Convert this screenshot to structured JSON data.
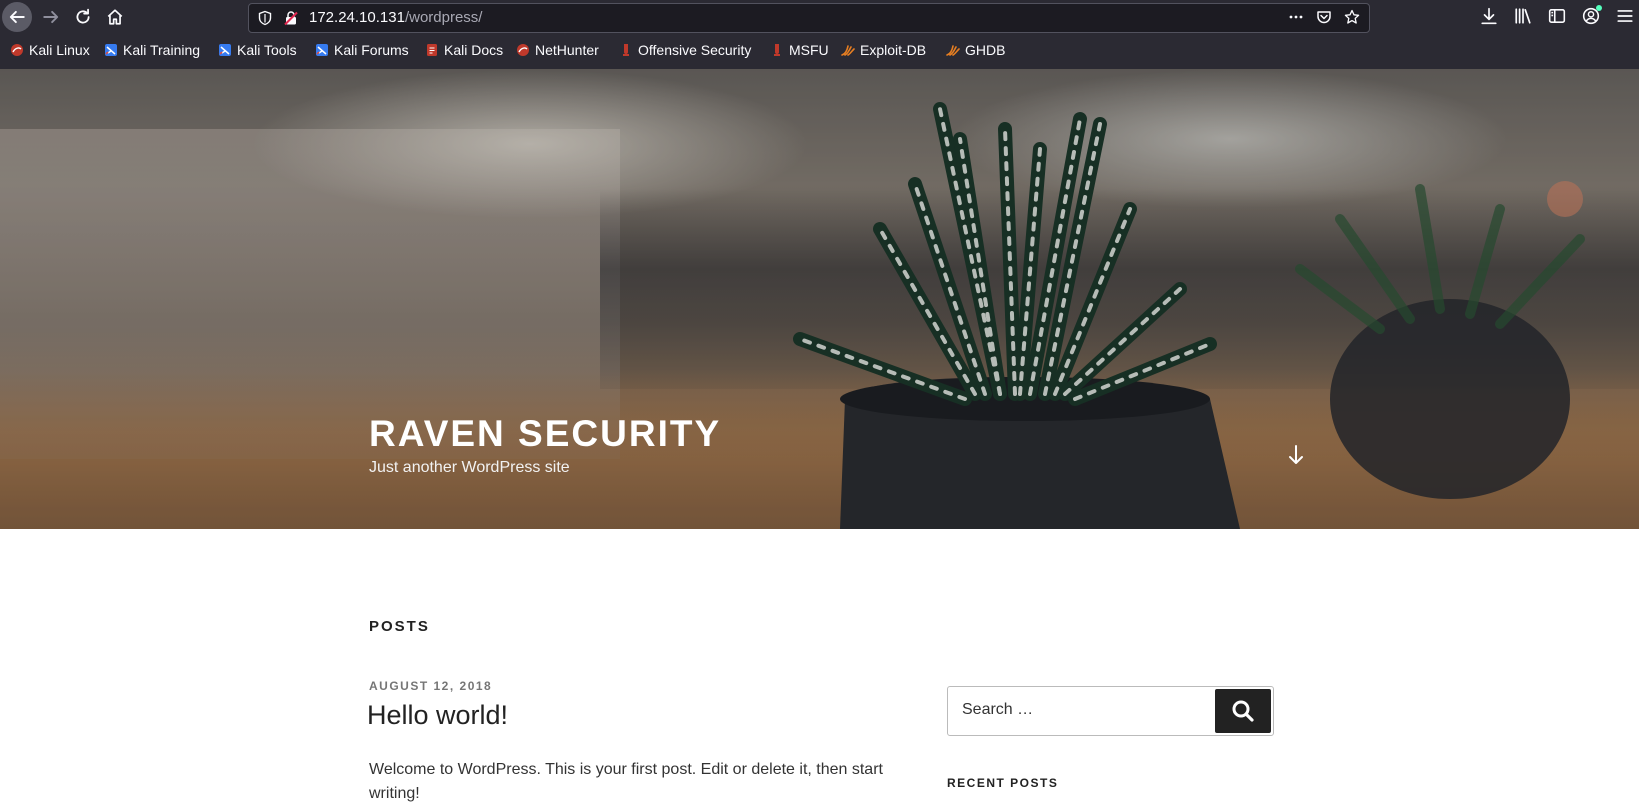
{
  "browser": {
    "url_host": "172.24.10.131",
    "url_path": "/wordpress/",
    "bookmarks": [
      {
        "label": "Kali Linux",
        "icon": "kali-dragon-icon"
      },
      {
        "label": "Kali Training",
        "icon": "kali-training-icon"
      },
      {
        "label": "Kali Tools",
        "icon": "kali-tools-icon"
      },
      {
        "label": "Kali Forums",
        "icon": "kali-forums-icon"
      },
      {
        "label": "Kali Docs",
        "icon": "kali-docs-icon"
      },
      {
        "label": "NetHunter",
        "icon": "nethunter-icon"
      },
      {
        "label": "Offensive Security",
        "icon": "offsec-icon"
      },
      {
        "label": "MSFU",
        "icon": "msfu-icon"
      },
      {
        "label": "Exploit-DB",
        "icon": "exploit-db-icon"
      },
      {
        "label": "GHDB",
        "icon": "ghdb-icon"
      }
    ]
  },
  "site": {
    "title": "RAVEN SECURITY",
    "description": "Just another WordPress site"
  },
  "main": {
    "section_title": "POSTS",
    "post": {
      "date": "AUGUST 12, 2018",
      "title": "Hello world!",
      "excerpt": "Welcome to WordPress. This is your first post. Edit or delete it, then start writing!"
    }
  },
  "sidebar": {
    "search_placeholder": "Search …",
    "recent_posts_title": "RECENT POSTS"
  },
  "colors": {
    "chrome_bg": "#2b2a33",
    "url_bg": "#1c1b22",
    "text_dark": "#222222",
    "search_button": "#222222"
  }
}
